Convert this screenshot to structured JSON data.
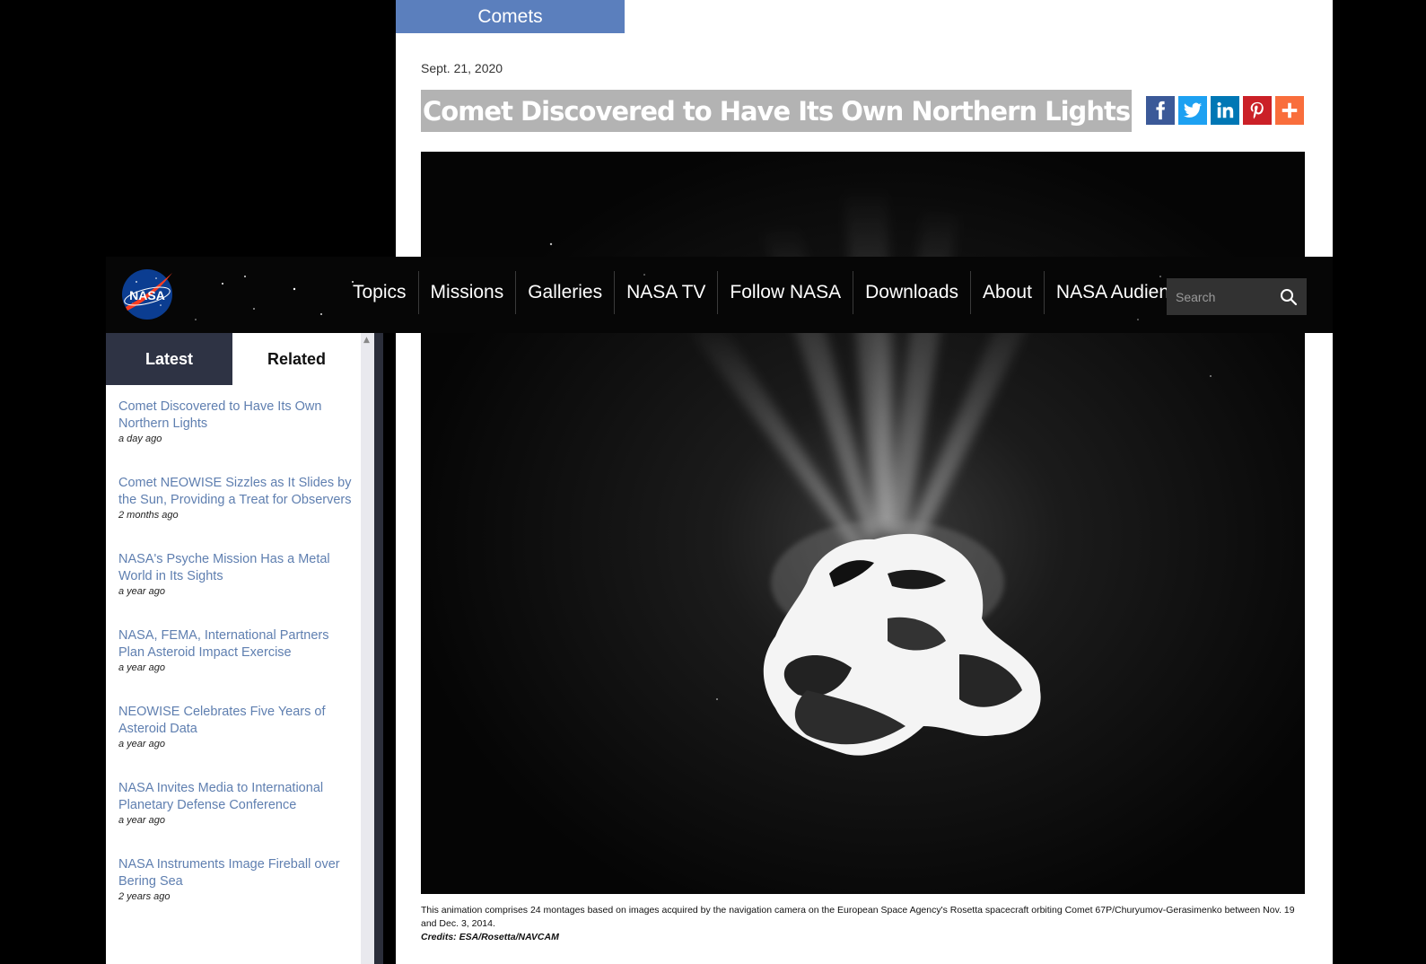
{
  "category": "Comets",
  "article": {
    "date": "Sept. 21, 2020",
    "title": "Comet Discovered to Have Its Own Northern Lights",
    "caption": "This animation comprises 24 montages based on images acquired by the navigation camera on the European Space Agency's Rosetta spacecraft orbiting Comet 67P/Churyumov-Gerasimenko between Nov. 19 and Dec. 3, 2014.",
    "credits": "Credits: ESA/Rosetta/NAVCAM"
  },
  "share": {
    "buttons": [
      {
        "icon": "facebook-icon",
        "color": "#3b5998"
      },
      {
        "icon": "twitter-icon",
        "color": "#1da1f2"
      },
      {
        "icon": "linkedin-icon",
        "color": "#0077b5"
      },
      {
        "icon": "pinterest-icon",
        "color": "#cb2027"
      },
      {
        "icon": "plus-icon",
        "color": "#f96e3c"
      }
    ]
  },
  "nav": {
    "logo_text": "NASA",
    "items": [
      "Topics",
      "Missions",
      "Galleries",
      "NASA TV",
      "Follow NASA",
      "Downloads",
      "About",
      "NASA Audiences"
    ],
    "search_placeholder": "Search"
  },
  "sidebar": {
    "tabs": [
      "Latest",
      "Related"
    ],
    "items": [
      {
        "title": "Comet Discovered to Have Its Own Northern Lights",
        "time": "a day ago"
      },
      {
        "title": "Comet NEOWISE Sizzles as It Slides by the Sun, Providing a Treat for Observers",
        "time": "2 months ago"
      },
      {
        "title": "NASA's Psyche Mission Has a Metal World in Its Sights",
        "time": "a year ago"
      },
      {
        "title": "NASA, FEMA, International Partners Plan Asteroid Impact Exercise",
        "time": "a year ago"
      },
      {
        "title": "NEOWISE Celebrates Five Years of Asteroid Data",
        "time": "a year ago"
      },
      {
        "title": "NASA Invites Media to International Planetary Defense Conference",
        "time": "a year ago"
      },
      {
        "title": "NASA Instruments Image Fireball over Bering Sea",
        "time": "2 years ago"
      }
    ]
  }
}
